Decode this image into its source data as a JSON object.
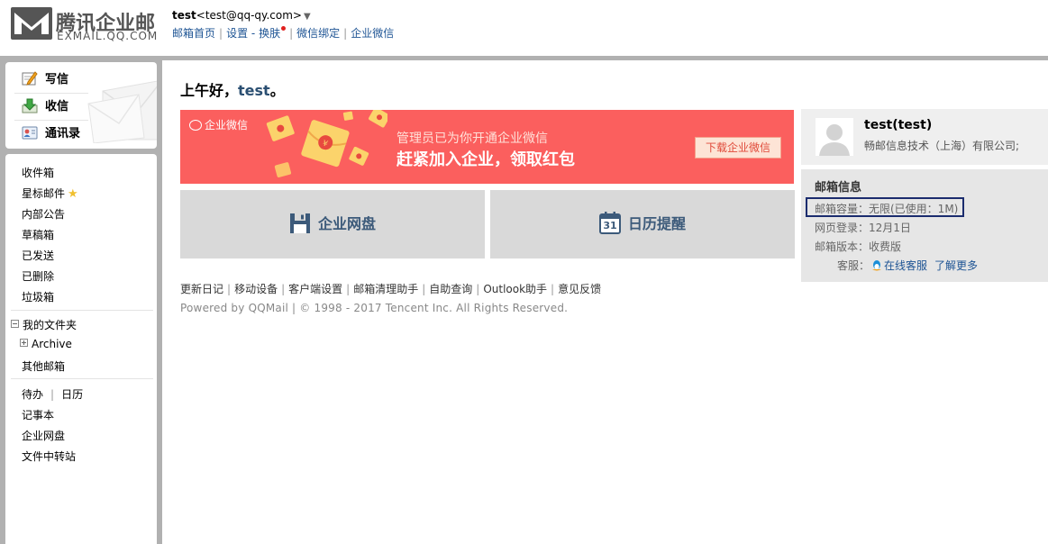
{
  "header": {
    "logo_cn": "腾讯企业邮",
    "logo_en": "EXMAIL.QQ.COM",
    "user_name": "test",
    "user_email": "<test@qq-qy.com>",
    "nav": {
      "home": "邮箱首页",
      "settings": "设置",
      "dash": "-",
      "skin": "换肤",
      "wechat_bind": "微信绑定",
      "enterprise_wechat": "企业微信"
    }
  },
  "sidebar": {
    "actions": {
      "compose": "写信",
      "inbox_receive": "收信",
      "contacts": "通讯录"
    },
    "folders": {
      "inbox": "收件箱",
      "starred": "星标邮件",
      "notice": "内部公告",
      "drafts": "草稿箱",
      "sent": "已发送",
      "deleted": "已删除",
      "spam": "垃圾箱"
    },
    "my_folders": "我的文件夹",
    "archive": "Archive",
    "other_mailbox": "其他邮箱",
    "todo": "待办",
    "calendar": "日历",
    "notes": "记事本",
    "netdisk": "企业网盘",
    "transfer": "文件中转站"
  },
  "main": {
    "greeting_prefix": "上午好，",
    "greeting_name": "test",
    "greeting_suffix": "。",
    "banner": {
      "tag": "企业微信",
      "line1": "管理员已为你开通企业微信",
      "line2": "赶紧加入企业，领取红包",
      "button": "下载企业微信"
    },
    "tiles": {
      "netdisk": "企业网盘",
      "calendar": "日历提醒",
      "calendar_day": "31"
    },
    "footer_links": [
      "更新日记",
      "移动设备",
      "客户端设置",
      "邮箱清理助手",
      "自助查询",
      "Outlook助手",
      "意见反馈"
    ],
    "powered": "Powered by QQMail  | © 1998 - 2017 Tencent Inc. All Rights Reserved."
  },
  "profile": {
    "name": "test(test)",
    "company": "畅邮信息技术（上海）有限公司;"
  },
  "mail_info": {
    "title": "邮箱信息",
    "quota": "邮箱容量：无限(已使用：1M)",
    "last_login": "网页登录：12月1日",
    "version": "邮箱版本：收费版",
    "service_label": "客服：",
    "online_service": "在线客服",
    "learn_more": "了解更多"
  },
  "colors": {
    "banner_bg": "#fb5f5e",
    "link": "#1e5494",
    "frame": "#b1b1b1",
    "quota_highlight": "#1b2c6e"
  }
}
